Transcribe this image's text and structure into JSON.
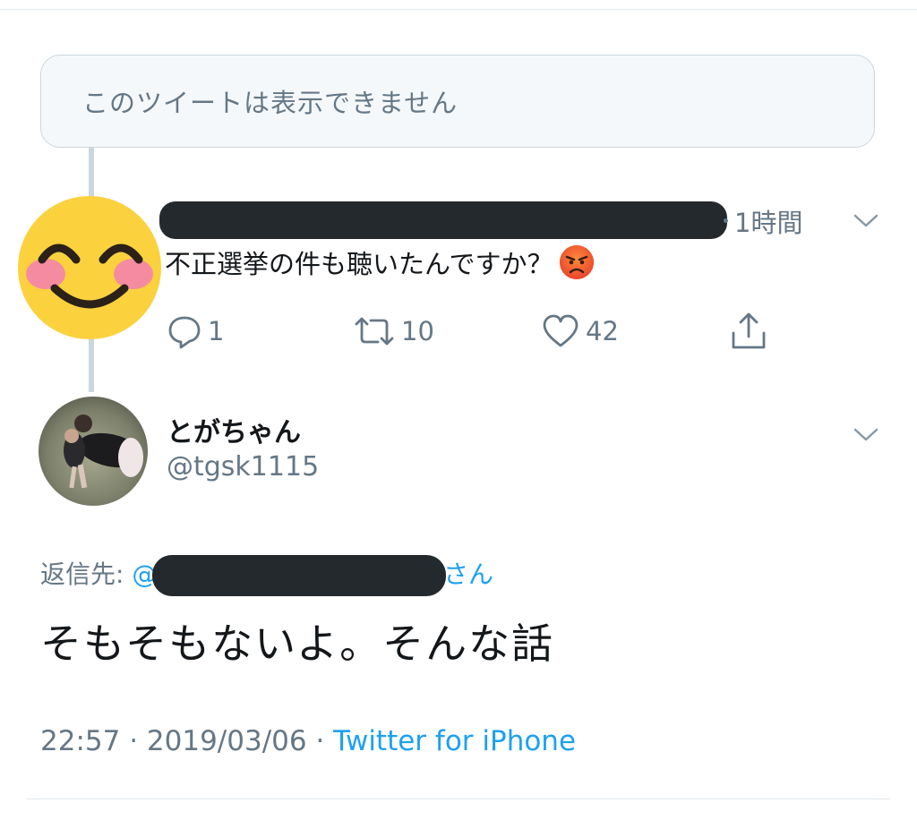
{
  "unavailable_notice": "このツイートは表示できません",
  "parent_tweet": {
    "time_ago": "1時間",
    "text": "不正選挙の件も聴いたんですか？",
    "emoji": "angry-face",
    "reply_count": "1",
    "retweet_count": "10",
    "like_count": "42"
  },
  "main_tweet": {
    "display_name": "とがちゃん",
    "handle": "@tgsk1115",
    "reply_to_label": "返信先: ",
    "reply_to_at": "@",
    "reply_to_suffix": "さん",
    "text": "そもそもないよ。そんな話",
    "time": "22:57",
    "separator": " · ",
    "date": "2019/03/06",
    "source": "Twitter for iPhone"
  },
  "colors": {
    "primary_text": "#14171a",
    "secondary_text": "#657786",
    "link_blue": "#1da1f2",
    "border": "#ccd6dd",
    "redaction": "#24292d"
  },
  "icons": {
    "reply": "reply-icon",
    "retweet": "retweet-icon",
    "like": "heart-icon",
    "share": "share-icon",
    "more": "chevron-down-icon"
  }
}
